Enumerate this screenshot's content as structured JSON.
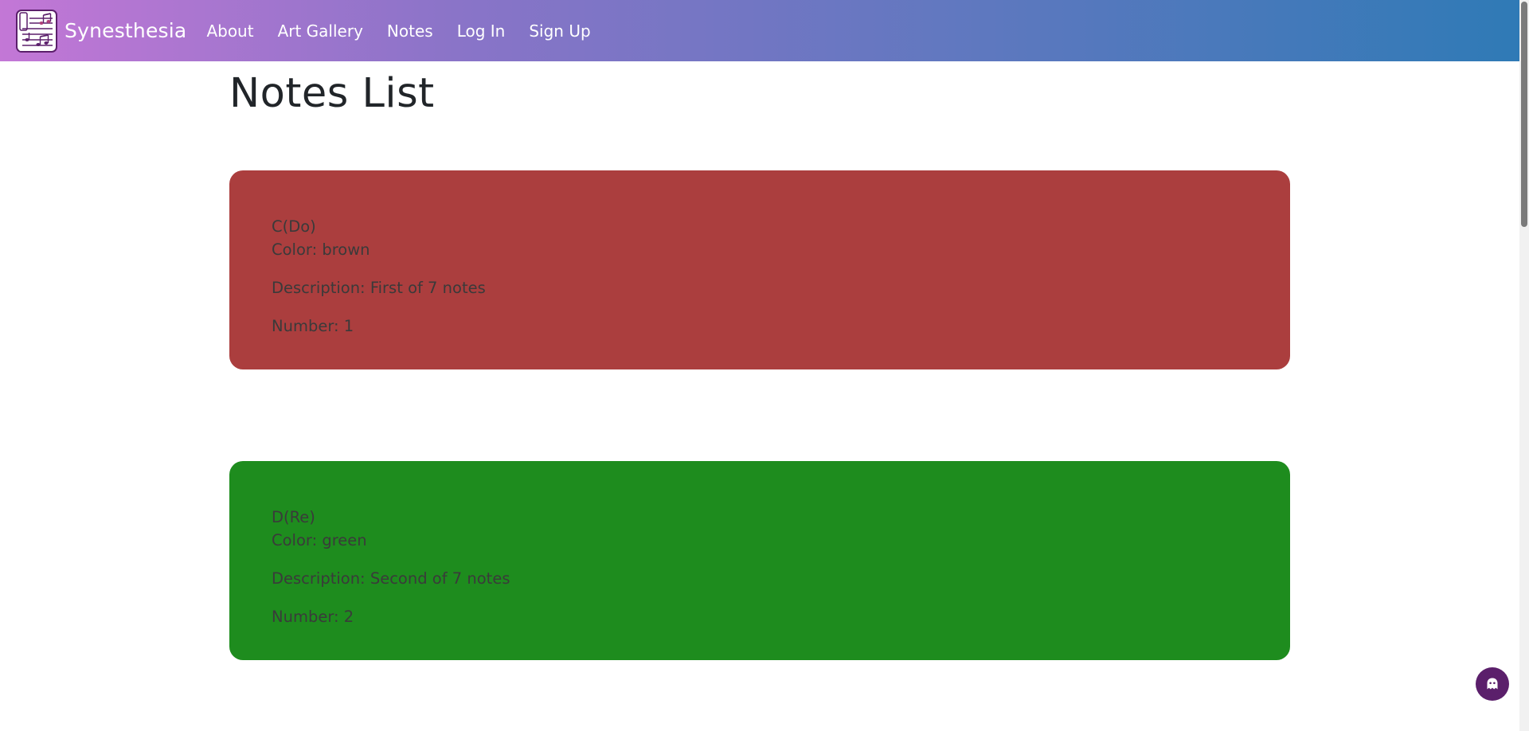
{
  "navbar": {
    "brand": "Synesthesia",
    "links": [
      "About",
      "Art Gallery",
      "Notes",
      "Log In",
      "Sign Up"
    ]
  },
  "page": {
    "title": "Notes List"
  },
  "notes": [
    {
      "name": "C(Do)",
      "color_text": "Color: brown",
      "description": "Description: First of 7 notes",
      "number": "Number: 1",
      "background": "#ab3e3e"
    },
    {
      "name": "D(Re)",
      "color_text": "Color: green",
      "description": "Description: Second of 7 notes",
      "number": "Number: 2",
      "background": "#1e8c1e"
    }
  ],
  "colors": {
    "nav_gradient_start": "#c377d6",
    "nav_gradient_end": "#2f7ab6",
    "chat_button": "#5b1f6b"
  },
  "icons": {
    "logo": "music-notes-sheet-icon",
    "chat": "ghost-icon"
  }
}
